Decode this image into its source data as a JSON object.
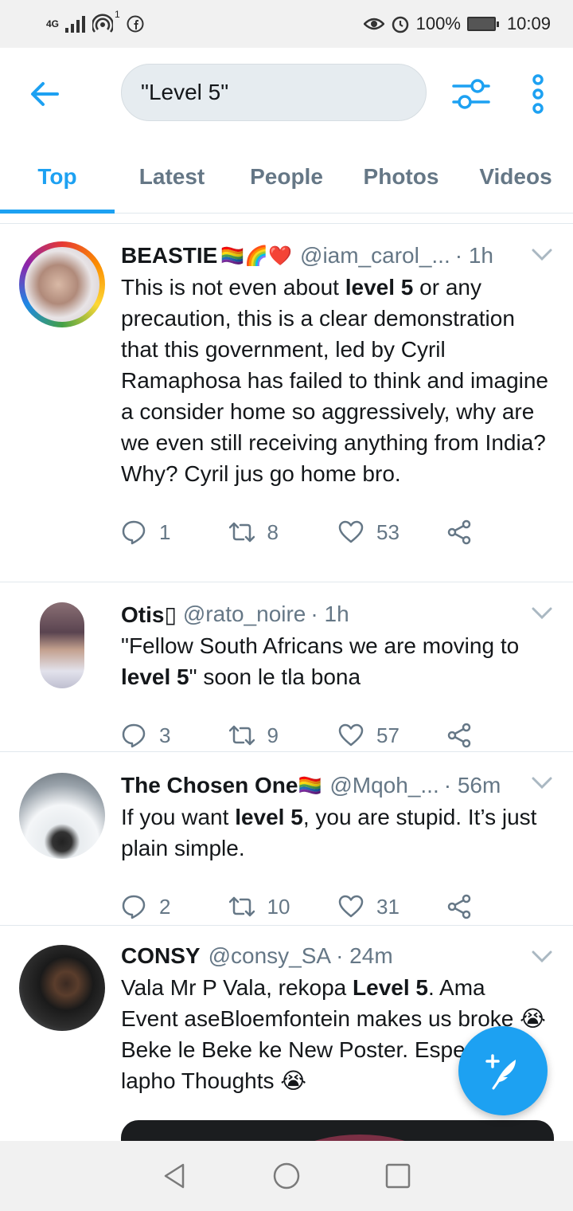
{
  "status_bar": {
    "network": "4G",
    "network_sub": "1",
    "battery": "100%",
    "time": "10:09"
  },
  "search": {
    "query": "\"Level 5\""
  },
  "tabs": [
    {
      "label": "Top",
      "active": true
    },
    {
      "label": "Latest",
      "active": false
    },
    {
      "label": "People",
      "active": false
    },
    {
      "label": "Photos",
      "active": false
    },
    {
      "label": "Videos",
      "active": false
    }
  ],
  "tweets": [
    {
      "name": "BEASTIE",
      "emoji": "🏳️‍🌈🌈❤️",
      "handle": "@iam_carol_...",
      "time": "· 1h",
      "body_parts": [
        "This is not even about ",
        "level 5",
        " or any precaution, this is a clear demonstration that this government, led by Cyril Ramaphosa has failed to think and imagine a consider home so aggressively, why are we even still receiving anything from India? Why? Cyril jus go home bro."
      ],
      "replies": "1",
      "retweets": "8",
      "likes": "53"
    },
    {
      "name": "Otis▯",
      "emoji": "",
      "handle": "@rato_noire",
      "time": "· 1h",
      "body_parts": [
        "\"Fellow South Africans we are moving to ",
        "level 5",
        "\" soon le tla bona"
      ],
      "replies": "3",
      "retweets": "9",
      "likes": "57"
    },
    {
      "name": "The Chosen One",
      "emoji": "🏳️‍🌈",
      "handle": "@Mqoh_...",
      "time": "· 56m",
      "body_parts": [
        "If you want ",
        "level 5",
        ", you are stupid. It’s just plain simple."
      ],
      "replies": "2",
      "retweets": "10",
      "likes": "31"
    },
    {
      "name": "CONSY",
      "emoji": "",
      "handle": "@consy_SA",
      "time": "· 24m",
      "body_parts": [
        "Vala Mr P Vala, rekopa ",
        "Level 5",
        ". Ama Event aseBloemfontein makes us broke 😭 Beke le Beke ke New Poster. Especially lapho Thoughts 😭"
      ]
    }
  ],
  "colors": {
    "accent": "#1da1f2",
    "secondary_text": "#657786",
    "divider": "#e1e8ed"
  }
}
